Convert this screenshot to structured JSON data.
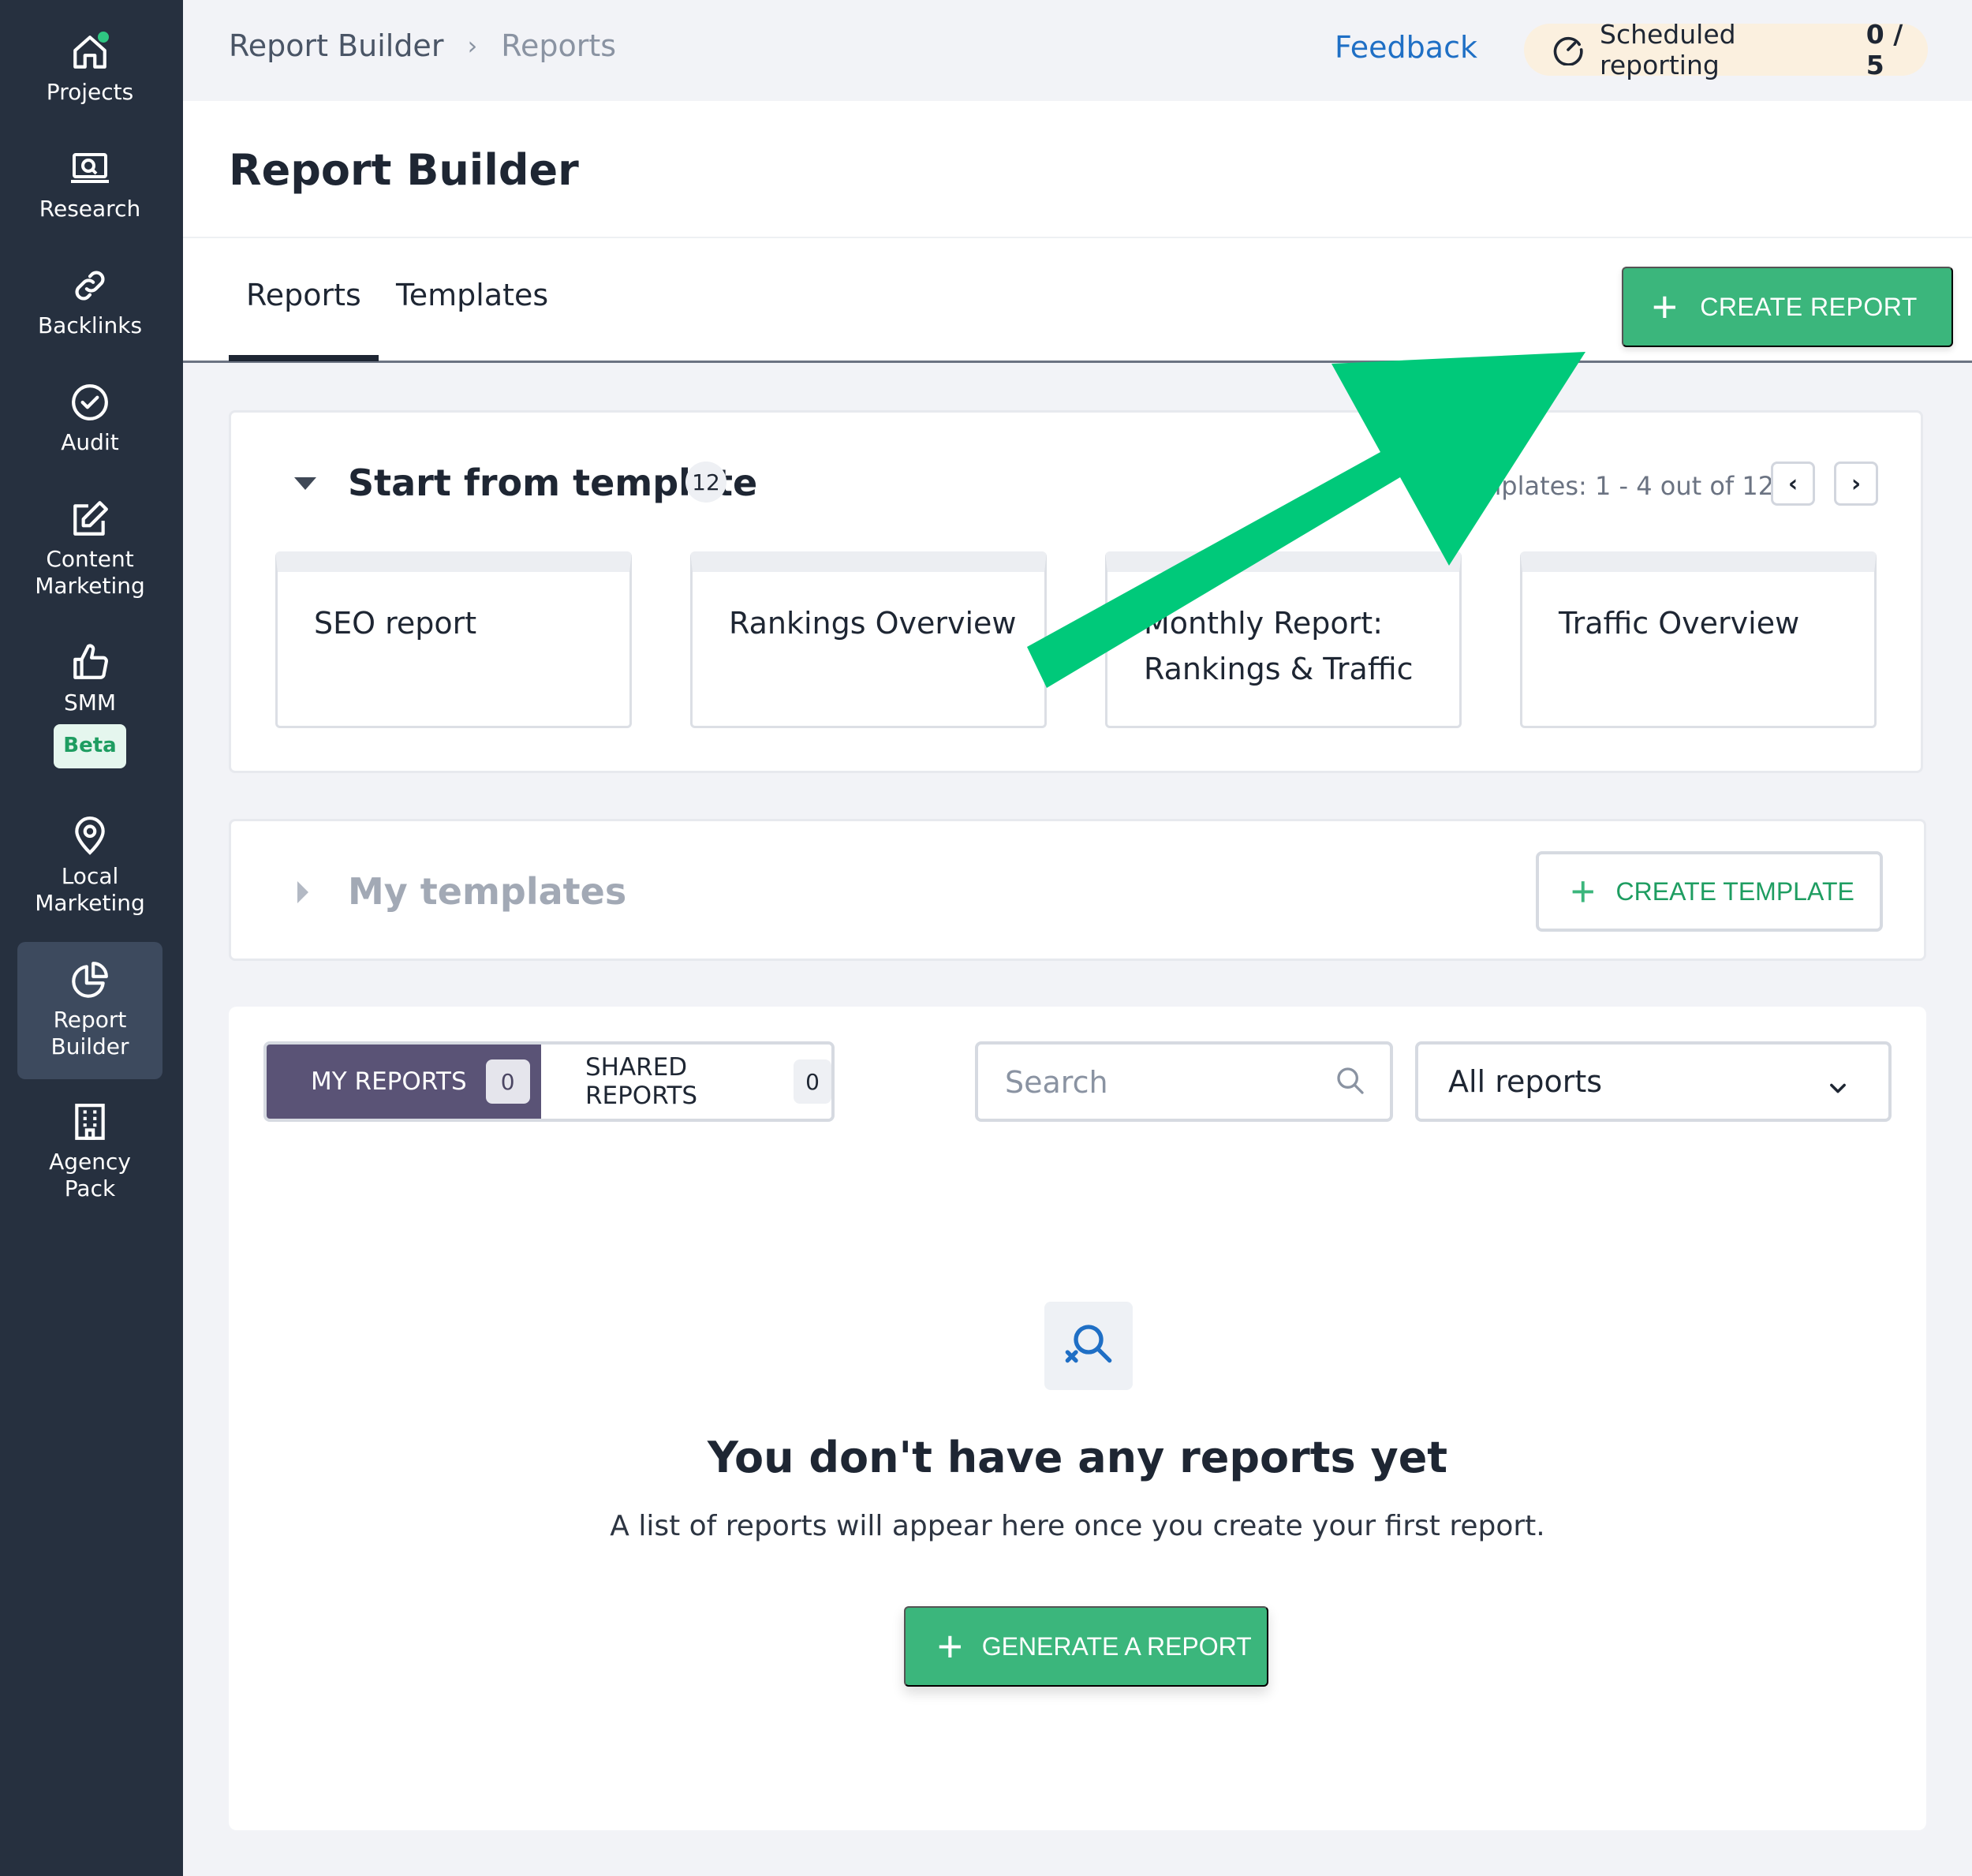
{
  "sidebar": {
    "items": [
      {
        "label": "Projects",
        "icon": "home-icon"
      },
      {
        "label": "Research",
        "icon": "research-icon"
      },
      {
        "label": "Backlinks",
        "icon": "link-icon"
      },
      {
        "label": "Audit",
        "icon": "check-circle-icon"
      },
      {
        "label": "Content Marketing",
        "icon": "edit-icon"
      },
      {
        "label": "SMM",
        "icon": "thumbs-up-icon",
        "badge": "Beta"
      },
      {
        "label": "Local Marketing",
        "icon": "map-pin-icon"
      },
      {
        "label": "Report Builder",
        "icon": "pie-chart-icon",
        "active": true
      },
      {
        "label": "Agency Pack",
        "icon": "building-icon"
      }
    ]
  },
  "topbar": {
    "breadcrumb": [
      "Report Builder",
      "Reports"
    ],
    "feedback": "Feedback",
    "scheduled_label": "Scheduled reporting",
    "scheduled_count": "0 / 5"
  },
  "header": {
    "title": "Report Builder"
  },
  "tabs": {
    "items": [
      "Reports",
      "Templates"
    ],
    "create_report": "CREATE REPORT"
  },
  "templates_section": {
    "title": "Start from template",
    "count": "12",
    "pager": "nplates: 1 - 4 out of 12",
    "cards": [
      "SEO report",
      "Rankings Overview",
      "Monthly Report: Rankings & Traffic",
      "Traffic Overview"
    ]
  },
  "my_templates": {
    "title": "My templates",
    "create_template": "CREATE TEMPLATE"
  },
  "reports_panel": {
    "my_reports": "MY REPORTS",
    "my_reports_count": "0",
    "shared_reports": "SHARED REPORTS",
    "shared_reports_count": "0",
    "search_placeholder": "Search",
    "filter_value": "All reports",
    "empty_title": "You don't have any reports yet",
    "empty_subtitle": "A list of reports will appear here once you create your first report.",
    "generate": "GENERATE A REPORT"
  },
  "colors": {
    "sidebar_bg": "#26303f",
    "accent_green": "#3bb67c",
    "link_blue": "#1f6fc5",
    "segment_active": "#5a5376",
    "annotation_arrow": "#00c97a"
  }
}
